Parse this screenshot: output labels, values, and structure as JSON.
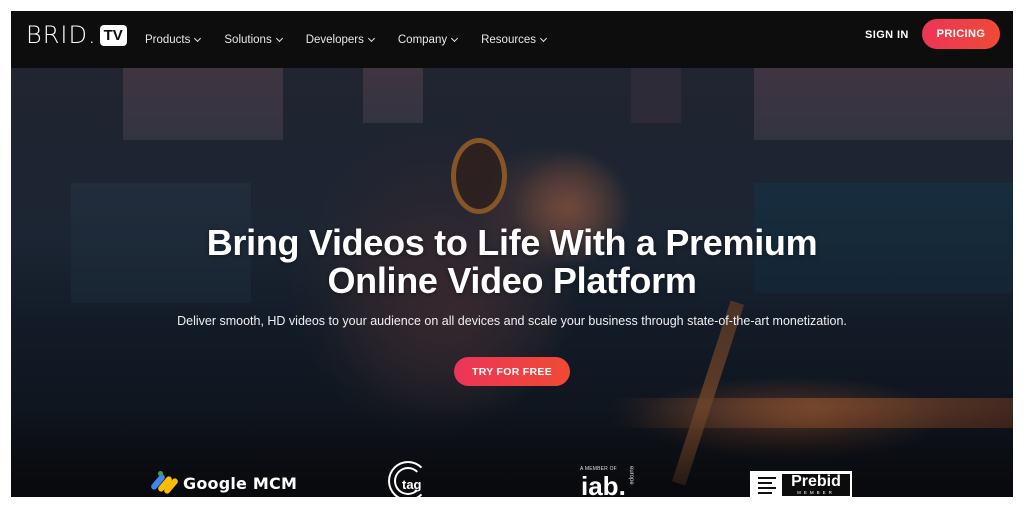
{
  "nav": {
    "logo": {
      "text": "BRID.",
      "badge": "TV"
    },
    "items": [
      {
        "label": "Products",
        "icon": "chevron-down-icon"
      },
      {
        "label": "Solutions",
        "icon": "chevron-down-icon"
      },
      {
        "label": "Developers",
        "icon": "chevron-down-icon"
      },
      {
        "label": "Company",
        "icon": "chevron-down-icon"
      },
      {
        "label": "Resources",
        "icon": "chevron-down-icon"
      }
    ],
    "sign_in": "SIGN IN",
    "pricing": "PRICING"
  },
  "hero": {
    "headline_line1": "Bring Videos to Life With a Premium",
    "headline_line2": "Online Video Platform",
    "subline": "Deliver smooth, HD videos to your audience on all devices and scale your business through state-of-the-art monetization.",
    "cta": "TRY FOR FREE"
  },
  "partners": {
    "google": {
      "name": "Google MCM",
      "icon": "google-mcm-icon"
    },
    "tag": {
      "name": "tag",
      "icon": "tag-logo-icon"
    },
    "iab": {
      "prefix": "A MEMBER OF",
      "name": "iab.",
      "region": "europe"
    },
    "prebid": {
      "name": "Prebid",
      "sub": "MEMBER",
      "icon": "prebid-lines-icon"
    }
  },
  "colors": {
    "accent_start": "#ec3558",
    "accent_end": "#ef4a35",
    "nav_bg": "#0d0d0e"
  }
}
